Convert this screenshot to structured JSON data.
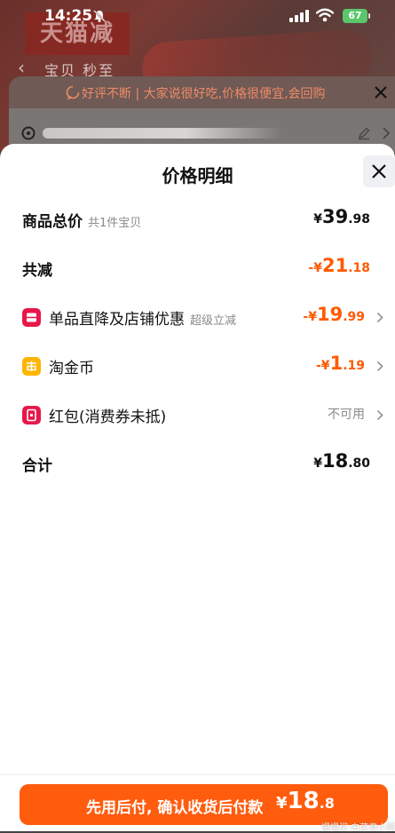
{
  "status_bar": {
    "time": "14:25",
    "battery": "67"
  },
  "background_page": {
    "logo_text": "天猫减",
    "nav_text": "宝贝 秒至",
    "notice_text": "好评不断 | 大家说很好吃,价格很便宜,会回购"
  },
  "sheet": {
    "title": "价格明细",
    "rows": [
      {
        "label": "商品总价",
        "sub": "共1件宝贝",
        "currency": "¥",
        "main": "39",
        "decimal": ".98"
      },
      {
        "label": "共减",
        "currency": "-¥",
        "main": "21",
        "decimal": ".18"
      },
      {
        "label": "单品直降及店铺优惠",
        "sub": "超级立减",
        "currency": "-¥",
        "main": "19",
        "decimal": ".99",
        "icon_color": "#e8174a"
      },
      {
        "label": "淘金币",
        "currency": "-¥",
        "main": "1",
        "decimal": ".19",
        "icon_color": "#ffb400"
      },
      {
        "label": "红包(消费券未抵)",
        "status": "不可用",
        "icon_color": "#e8174a"
      },
      {
        "label": "合计",
        "currency": "¥",
        "main": "18",
        "decimal": ".80"
      }
    ]
  },
  "bottom": {
    "button_text": "先用后付, 确认收货后付款",
    "price_currency": "¥",
    "price_main": "18",
    "price_decimal": ".8",
    "watermark": "慢慢买·白菜君小锅"
  },
  "colors": {
    "accent": "#ff5c0e",
    "discount": "#ff5a00",
    "notice": "#f08a66"
  },
  "icons": [
    "mute-icon",
    "signal-icon",
    "wifi-icon",
    "battery-icon",
    "back-icon",
    "notice-icon",
    "close-icon",
    "location-icon",
    "edit-icon",
    "chevron-right-icon",
    "coupon-icon",
    "coin-icon",
    "red-packet-icon"
  ]
}
